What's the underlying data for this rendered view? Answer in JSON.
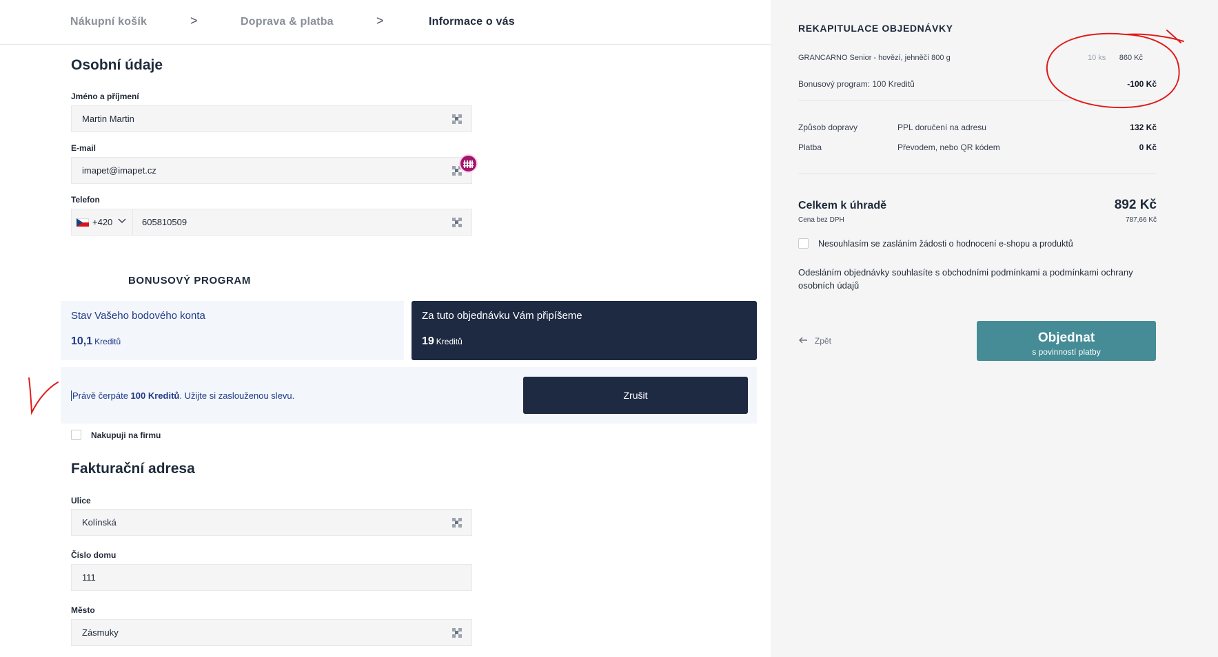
{
  "breadcrumb": {
    "step1": "Nákupní košík",
    "step2": "Doprava & platba",
    "step3": "Informace o vás",
    "separator": ">"
  },
  "personal": {
    "title": "Osobní údaje",
    "name_label": "Jméno a příjmení",
    "name_value": "Martin Martin",
    "email_label": "E-mail",
    "email_value": "imapet@imapet.cz",
    "phone_label": "Telefon",
    "phone_prefix": "+420",
    "phone_value": "605810509"
  },
  "bonus": {
    "heading": "BONUSOVÝ PROGRAM",
    "balance_title": "Stav Vašeho bodového konta",
    "balance_value": "10,1",
    "balance_unit": "Kreditů",
    "earn_title": "Za tuto objednávku Vám připíšeme",
    "earn_value": "19",
    "earn_unit": "Kreditů",
    "redeem_prefix": "Právě čerpáte ",
    "redeem_amount": "100 Kreditů",
    "redeem_suffix": ". Užijte si zaslouženou slevu.",
    "cancel_label": "Zrušit"
  },
  "company_checkbox_label": "Nakupuji na firmu",
  "billing": {
    "title": "Fakturační adresa",
    "street_label": "Ulice",
    "street_value": "Kolínská",
    "number_label": "Číslo domu",
    "number_value": "111",
    "city_label": "Město",
    "city_value": "Zásmuky"
  },
  "summary": {
    "title": "REKAPITULACE OBJEDNÁVKY",
    "item_name": "GRANCARNO Senior - hovězí, jehněčí 800 g",
    "item_qty": "10 ks",
    "item_price": "860 Kč",
    "bonus_label": "Bonusový program: 100 Kreditů",
    "bonus_price": "-100 Kč",
    "shipping_label": "Způsob dopravy",
    "shipping_method": "PPL doručení na adresu",
    "shipping_price": "132 Kč",
    "payment_label": "Platba",
    "payment_method": "Převodem, nebo QR kódem",
    "payment_price": "0 Kč",
    "total_label": "Celkem k úhradě",
    "total_value": "892 Kč",
    "total_sub": "Cena bez DPH",
    "total_net": "787,66 Kč",
    "review_optout_label": "Nesouhlasím se zasláním žádosti o hodnocení e-shopu a produktů",
    "terms_text": "Odesláním objednávky souhlasíte s obchodními podmínkami a podmínkami ochrany osobních údajů",
    "back_label": "Zpět",
    "order_label": "Objednat",
    "order_sub": "s povinností platby"
  },
  "colors": {
    "navy": "#1e2a42",
    "teal": "#458c96",
    "link_blue": "#1f3a8a",
    "annotation_red": "#e01b1b"
  }
}
